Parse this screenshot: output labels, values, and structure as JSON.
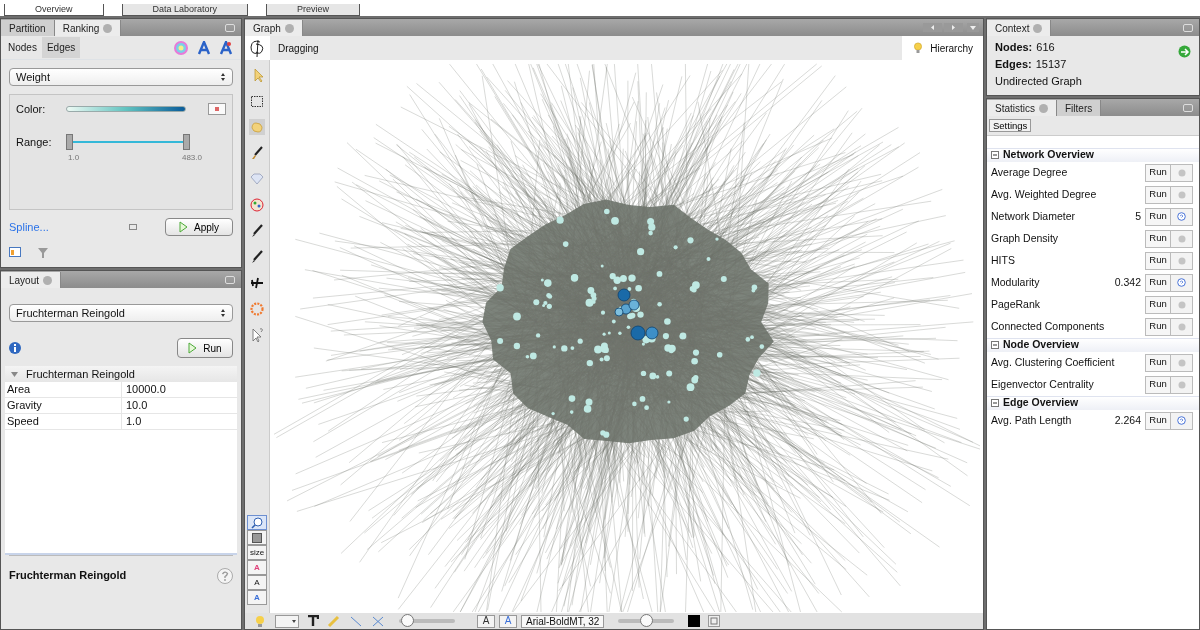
{
  "top_buttons": [
    {
      "label": "Overview",
      "selected": true
    },
    {
      "label": "Data Laboratory",
      "selected": false
    },
    {
      "label": "Preview",
      "selected": false
    }
  ],
  "ranking_panel": {
    "tabs": [
      {
        "label": "Partition",
        "selected": false
      },
      {
        "label": "Ranking",
        "selected": true
      }
    ],
    "element_tabs": [
      {
        "label": "Nodes",
        "selected": false
      },
      {
        "label": "Edges",
        "selected": true
      }
    ],
    "attribute": "Weight",
    "color_label": "Color:",
    "range_label": "Range:",
    "range_fill": {
      "level": 1
    },
    "range_min": "1.0",
    "range_max": "483.0",
    "spline_link": "Spline...",
    "apply_button": "Apply"
  },
  "layout_panel": {
    "title": "Layout",
    "algorithm": "Fruchterman Reingold",
    "run_button": "Run",
    "property_group": "Fruchterman Reingold",
    "properties": [
      {
        "name": "Area",
        "value": "10000.0"
      },
      {
        "name": "Gravity",
        "value": "10.0"
      },
      {
        "name": "Speed",
        "value": "1.0"
      }
    ],
    "description_title": "Fruchterman Reingold"
  },
  "graph_panel": {
    "title": "Graph",
    "mode": "Dragging",
    "hierarchy": "Hierarchy",
    "side_buttons": [
      {
        "kind": "zoom",
        "selected": true
      },
      {
        "kind": "square",
        "selected": false
      },
      {
        "kind": "text",
        "label": "size",
        "selected": false
      },
      {
        "kind": "text",
        "label": "A",
        "color": "#e0407a",
        "selected": false
      },
      {
        "kind": "text",
        "label": "A",
        "selected": false
      },
      {
        "kind": "text",
        "label": "A",
        "color": "#3a6fd8",
        "selected": false
      }
    ],
    "font_buttons": [
      "A",
      "A"
    ],
    "font_field": "Arial-BoldMT, 32",
    "edge_scale": {
      "level": 0.15
    },
    "label_scale": {
      "level": 0.5
    }
  },
  "context_panel": {
    "title": "Context",
    "nodes_label": "Nodes:",
    "nodes": "616",
    "edges_label": "Edges:",
    "edges": "15137",
    "graph_type": "Undirected Graph"
  },
  "statistics_panel": {
    "tabs": [
      {
        "label": "Statistics",
        "selected": true
      },
      {
        "label": "Filters",
        "selected": false
      }
    ],
    "settings_button": "Settings",
    "sections": [
      {
        "title": "Network Overview",
        "items": [
          {
            "name": "Average Degree",
            "run": "Run",
            "computed": false
          },
          {
            "name": "Avg. Weighted Degree",
            "run": "Run",
            "computed": false
          },
          {
            "name": "Network Diameter",
            "result": "5",
            "run": "Run",
            "computed": true
          },
          {
            "name": "Graph Density",
            "run": "Run",
            "computed": false
          },
          {
            "name": "HITS",
            "run": "Run",
            "computed": false
          },
          {
            "name": "Modularity",
            "result": "0.342",
            "run": "Run",
            "computed": true
          },
          {
            "name": "PageRank",
            "run": "Run",
            "computed": false
          },
          {
            "name": "Connected Components",
            "run": "Run",
            "computed": false
          }
        ]
      },
      {
        "title": "Node Overview",
        "items": [
          {
            "name": "Avg. Clustering Coefficient",
            "run": "Run",
            "computed": false
          },
          {
            "name": "Eigenvector Centrality",
            "run": "Run",
            "computed": false
          }
        ]
      },
      {
        "title": "Edge Overview",
        "items": [
          {
            "name": "Avg. Path Length",
            "result": "2.264",
            "run": "Run",
            "computed": true
          }
        ]
      }
    ]
  }
}
